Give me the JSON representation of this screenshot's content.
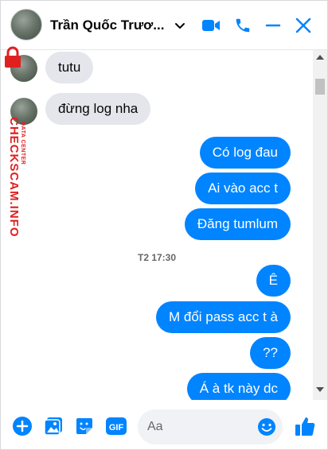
{
  "header": {
    "title": "Trần Quốc Trươ...",
    "icons": [
      "video-call-icon",
      "phone-call-icon",
      "minimize-icon",
      "close-icon"
    ]
  },
  "watermark": {
    "text": "CHECKSCAM.INFO",
    "small": "DATA CENTER"
  },
  "messages": [
    {
      "side": "in",
      "text": "tutu"
    },
    {
      "side": "in",
      "text": "đừng log nha"
    },
    {
      "side": "out",
      "text": "Có log đau"
    },
    {
      "side": "out",
      "text": "Ai vào acc t"
    },
    {
      "side": "out",
      "text": "Đăng tumlum"
    },
    {
      "side": "out",
      "text": "Ê"
    },
    {
      "side": "out",
      "text": "M đổi pass acc t à"
    },
    {
      "side": "out",
      "text": "??"
    },
    {
      "side": "out",
      "text": "Á à tk này dc"
    }
  ],
  "timestamp": "T2 17:30",
  "composer": {
    "placeholder": "Aa",
    "icons": [
      "add-icon",
      "image-icon",
      "sticker-icon",
      "gif-icon",
      "emoji-icon",
      "like-icon"
    ],
    "gif_label": "GIF"
  },
  "colors": {
    "accent": "#0084ff",
    "incoming": "#e4e6eb",
    "watermark": "#e02020"
  }
}
